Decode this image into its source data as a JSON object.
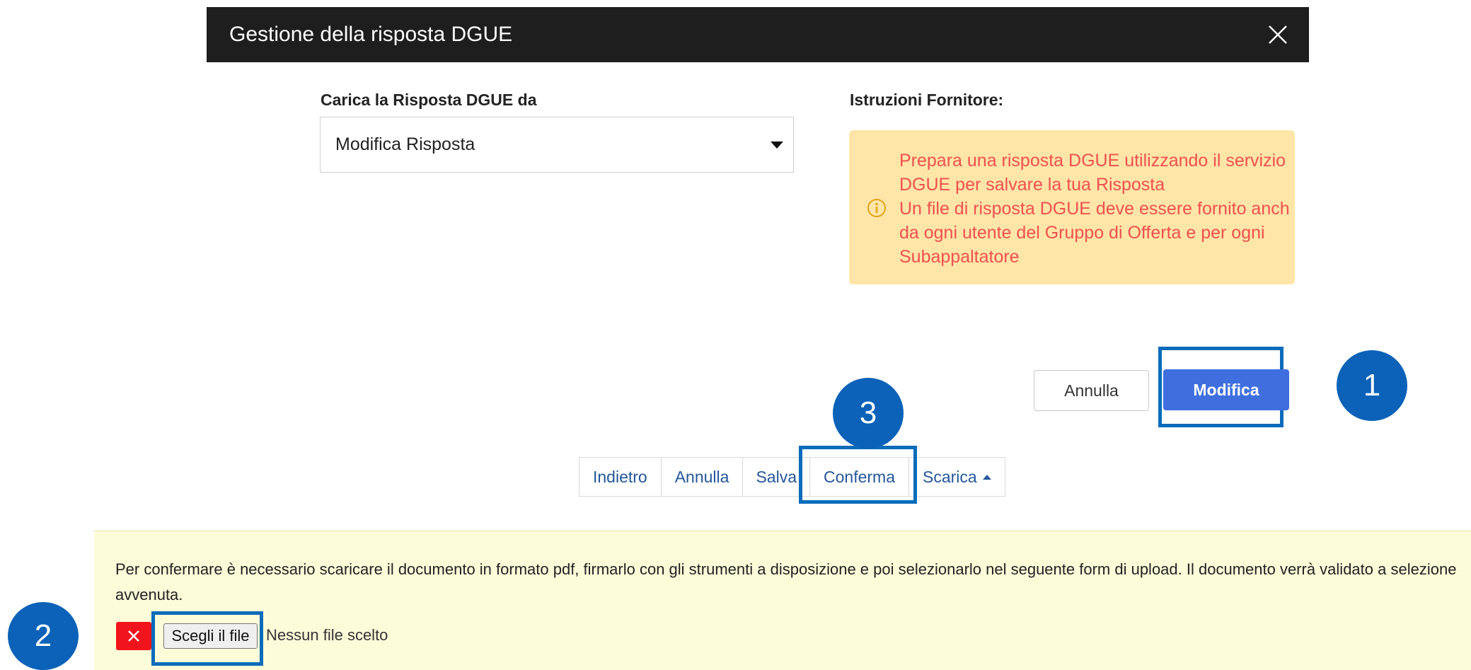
{
  "modal": {
    "title": "Gestione della risposta DGUE",
    "close_icon": "close-icon"
  },
  "load_section": {
    "label": "Carica la Risposta DGUE da",
    "selected_option": "Modifica Risposta"
  },
  "instructions": {
    "label": "Istruzioni Fornitore:",
    "text": "Prepara una risposta DGUE utilizzando il servizio\nDGUE per salvare la tua Risposta\nUn file di risposta DGUE deve essere fornito anch\nda ogni utente del Gruppo di Offerta e per ogni\nSubappaltatore",
    "icon": "info-icon"
  },
  "modal_actions": {
    "cancel": "Annulla",
    "modify": "Modifica"
  },
  "toolbar": {
    "back": "Indietro",
    "cancel": "Annulla",
    "save": "Salva",
    "confirm": "Conferma",
    "download": "Scarica"
  },
  "notice": {
    "text": "Per confermare è necessario scaricare il documento in formato pdf, firmarlo con gli strumenti a disposizione e poi selezionarlo nel seguente form di upload. Il documento verrà validato a selezione avvenuta.",
    "choose_file": "Scegli il file",
    "no_file": "Nessun file scelto"
  },
  "badges": {
    "one": "1",
    "two": "2",
    "three": "3"
  },
  "colors": {
    "header_bg": "#1e1e1e",
    "primary_button": "#3f6fdf",
    "highlight": "#0a6cba",
    "badge": "#0b62b8",
    "instructions_bg": "#ffe6a8",
    "instructions_text": "#f04f4f",
    "notice_bg": "#fdfcd9",
    "remove_button": "#f2141c"
  }
}
